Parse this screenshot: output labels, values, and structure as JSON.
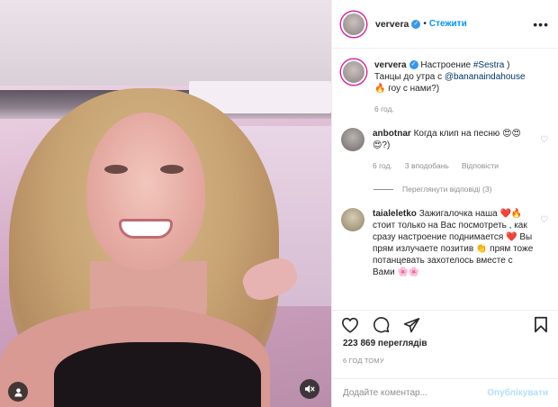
{
  "header": {
    "username": "ververa",
    "separator": "•",
    "follow_label": "Стежити",
    "more_icon": "•••"
  },
  "caption": {
    "username": "ververa",
    "text_1": " Настроение ",
    "hashtag": "#Sestra",
    "text_2": " )",
    "text_3": "Танцы до утра с ",
    "mention": "@bananaindahouse",
    "text_4": "🔥 гоу с нами?)",
    "time": "6 год."
  },
  "comments": [
    {
      "username": "anbotnar",
      "text": "Когда клип на песню 😍😍😍?)",
      "time": "6 год.",
      "likes": "3 вподобань",
      "reply": "Відповісти",
      "view_replies": "Переглянути відповіді (3)"
    },
    {
      "username": "taialeletko",
      "text": "Зажигалочка наша ❤️🔥 стоит только на Вас посмотреть , как сразу настроение поднимается ❤️ Вы прям излучаете позитив 👏 прям тоже потанцевать захотелось вместе с Вами 🌸🌸"
    }
  ],
  "post": {
    "views": "223 869 переглядів",
    "time": "6 ГОД ТОМУ"
  },
  "add_comment": {
    "placeholder": "Додайте коментар...",
    "post_label": "Опублікувати"
  },
  "colors": {
    "accent": "#0095f6",
    "verified": "#3897f0"
  }
}
